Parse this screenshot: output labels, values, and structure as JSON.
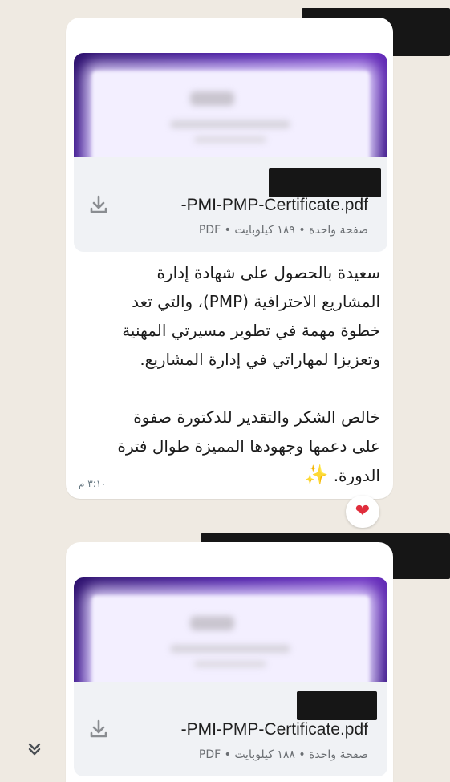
{
  "messages": [
    {
      "file": {
        "name": "-PMI-PMP-Certificate.pdf",
        "meta": "صفحة واحدة • ١٨٩ كيلوبايت • PDF"
      },
      "text_lines": [
        "سعيدة بالحصول على شهادة إدارة",
        "المشاريع الاحترافية (PMP)، والتي تعد",
        "خطوة مهمة في تطوير مسيرتي المهنية",
        "وتعزيزا لمهاراتي في إدارة المشاريع."
      ],
      "text_lines2": [
        "خالص الشكر والتقدير للدكتورة صفوة",
        "على دعمها وجهودها المميزة طوال فترة",
        "الدورة."
      ],
      "emoji": "✨",
      "time": "٣:١٠ م",
      "reaction": "❤"
    },
    {
      "file": {
        "name": "-PMI-PMP-Certificate.pdf",
        "meta": "صفحة واحدة • ١٨٨ كيلوبايت • PDF"
      }
    }
  ],
  "icons": {
    "download": "download-icon",
    "scroll_down": "double-chevron-down-icon"
  },
  "colors": {
    "background": "#efeae2",
    "bubble": "#ffffff",
    "file_row": "#f0f2f5",
    "reaction_heart": "#e02d3c"
  }
}
